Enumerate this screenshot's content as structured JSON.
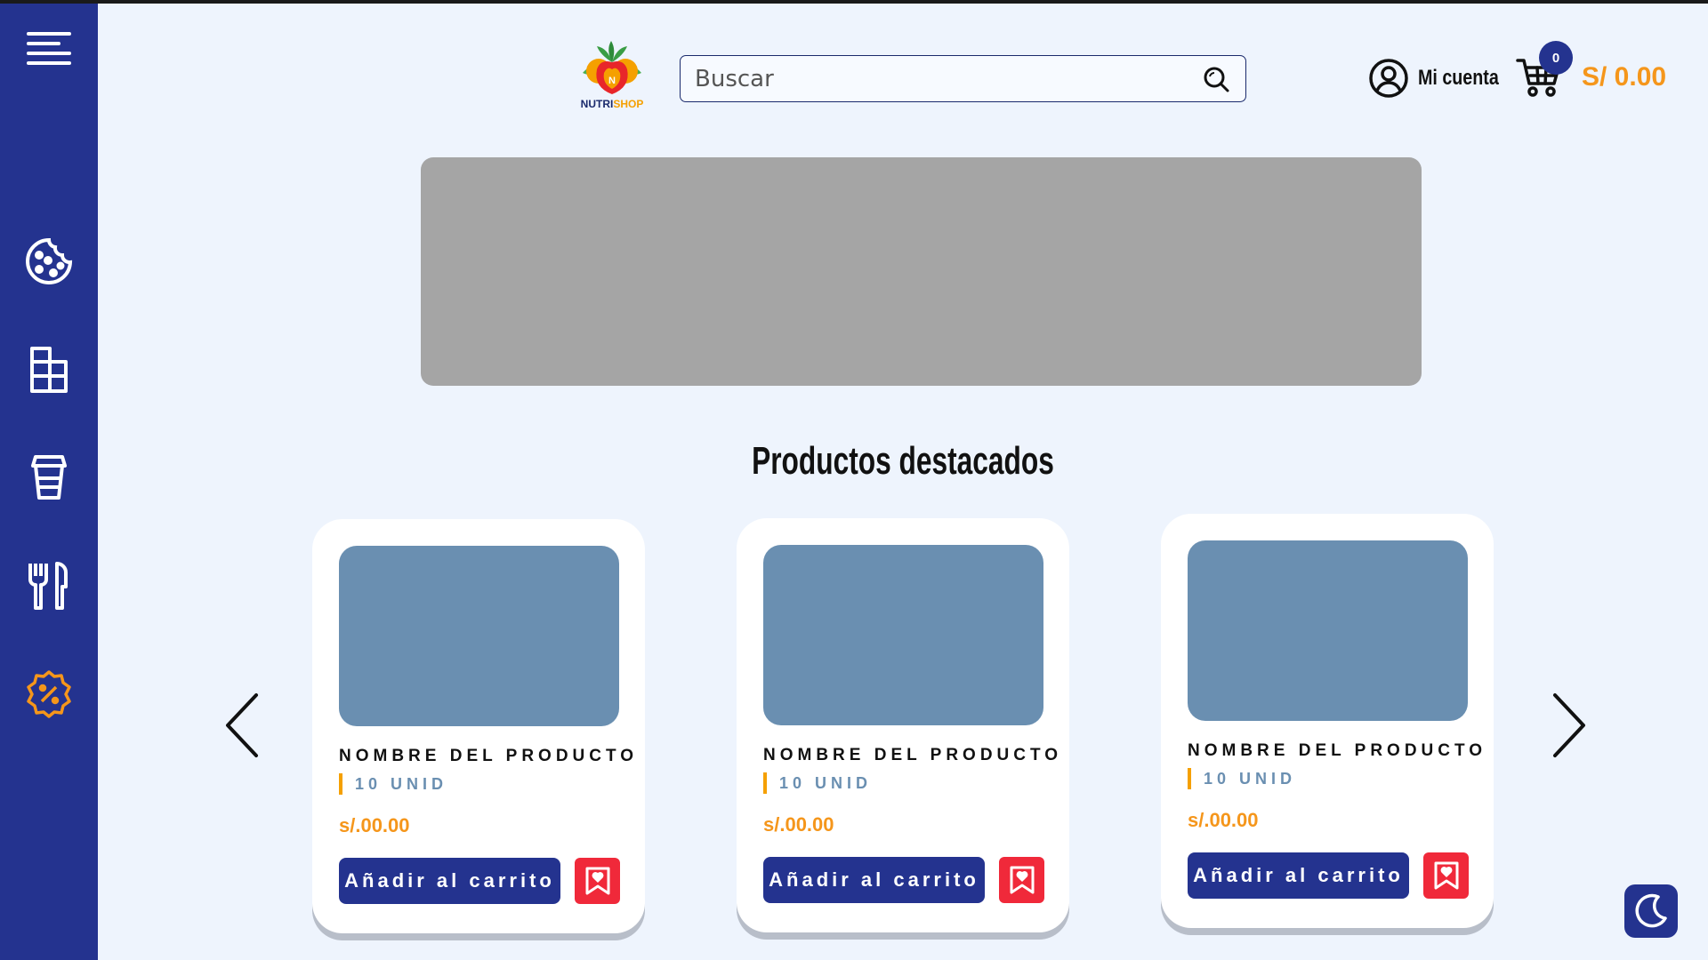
{
  "sidebar": {
    "menu_icon": "hamburger-menu-icon",
    "items": [
      {
        "icon": "cookie-icon"
      },
      {
        "icon": "grid-table-icon"
      },
      {
        "icon": "cup-icon"
      },
      {
        "icon": "fork-knife-icon"
      },
      {
        "icon": "discount-badge-icon",
        "active": true
      }
    ],
    "active_color": "#f5961b"
  },
  "header": {
    "logo": {
      "part1": "NUTRI",
      "part2": "SHOP"
    },
    "search": {
      "placeholder": "Buscar",
      "value": ""
    },
    "account_label": "Mi cuenta",
    "cart_count": "0",
    "cart_total": "S/ 0.00"
  },
  "featured": {
    "title": "Productos destacados",
    "products": [
      {
        "name": "NOMBRE DEL PRODUCTO",
        "qty": "10 UNID",
        "price": "s/.00.00",
        "add_label": "Añadir al carrito"
      },
      {
        "name": "NOMBRE DEL PRODUCTO",
        "qty": "10 UNID",
        "price": "s/.00.00",
        "add_label": "Añadir al carrito"
      },
      {
        "name": "NOMBRE DEL PRODUCTO",
        "qty": "10 UNID",
        "price": "s/.00.00",
        "add_label": "Añadir al carrito"
      }
    ]
  },
  "colors": {
    "primary": "#24338f",
    "accent": "#f5961b",
    "danger": "#f0293a",
    "background": "#eef4fd",
    "placeholder_image": "#6a8fb1",
    "banner": "#a5a5a5"
  }
}
